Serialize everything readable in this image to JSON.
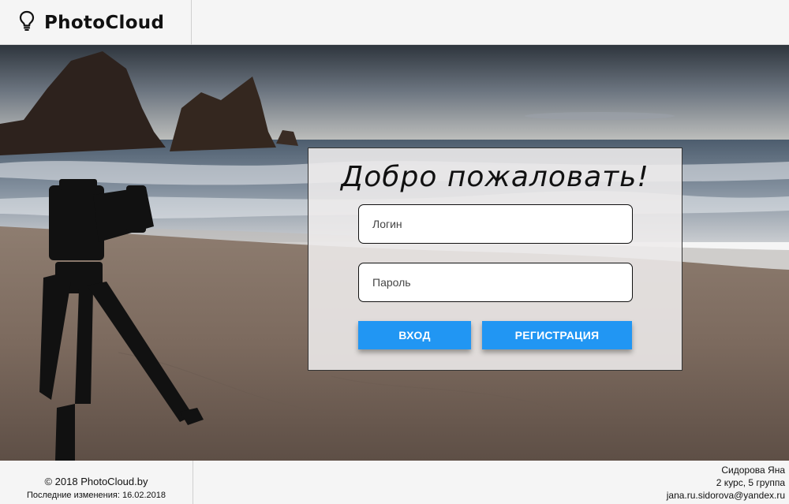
{
  "header": {
    "brand": "PhotoCloud",
    "brand_icon": "lightbulb-icon"
  },
  "login": {
    "welcome": "Добро пожаловать!",
    "login_placeholder": "Логин",
    "password_placeholder": "Пароль",
    "login_button": "ВХОД",
    "register_button": "РЕГИСТРАЦИЯ"
  },
  "footer": {
    "copyright": "© 2018 PhotoCloud.by",
    "last_updated": "Последние изменения: 16.02.2018",
    "author_name": "Сидорова Яна",
    "author_course": "2 курс, 5 группа",
    "author_email": "jana.ru.sidorova@yandex.ru"
  },
  "colors": {
    "accent": "#2196f3",
    "background": "#f5f5f5"
  }
}
